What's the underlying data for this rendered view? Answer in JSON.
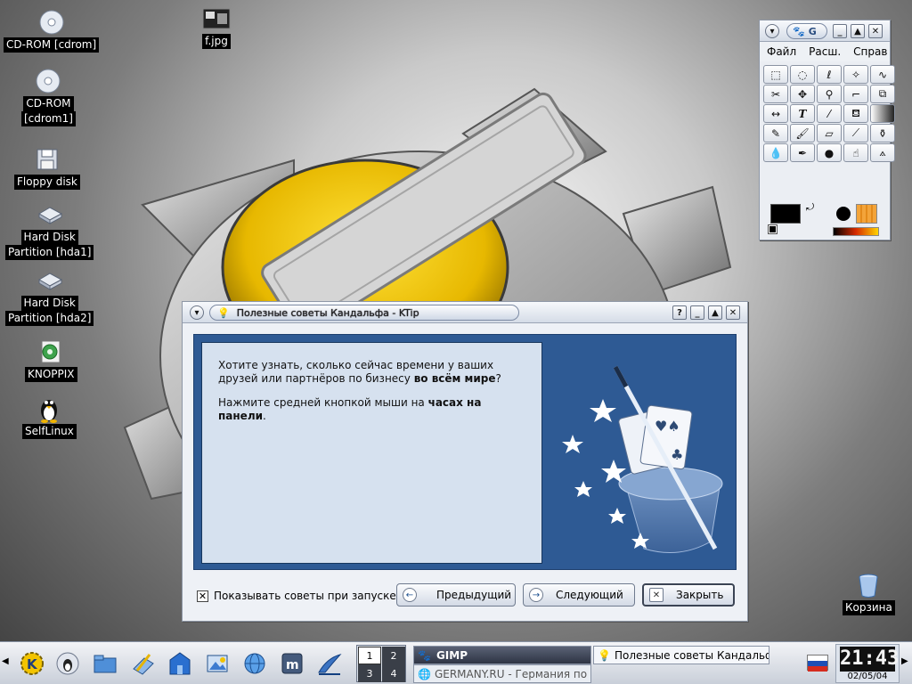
{
  "desktop": {
    "icons": [
      {
        "label": "CD-ROM [cdrom]",
        "icon": "cdrom-icon"
      },
      {
        "label": "CD-ROM",
        "label2": "[cdrom1]",
        "icon": "cdrom-icon"
      },
      {
        "label": "Floppy disk",
        "icon": "floppy-icon"
      },
      {
        "label": "Hard Disk",
        "label2": "Partition [hda1]",
        "icon": "harddisk-icon"
      },
      {
        "label": "Hard Disk",
        "label2": "Partition [hda2]",
        "icon": "harddisk-icon"
      },
      {
        "label": "KNOPPIX",
        "icon": "knoppix-icon"
      },
      {
        "label": "SelfLinux",
        "icon": "tux-icon"
      },
      {
        "label": "f.jpg",
        "icon": "image-file-icon"
      },
      {
        "label": "Корзина",
        "icon": "trash-icon"
      }
    ]
  },
  "gimp": {
    "title_letter": "G",
    "menu": [
      "Файл",
      "Расш.",
      "Справ"
    ],
    "tools": [
      "rect-select-icon",
      "ellipse-select-icon",
      "lasso-icon",
      "magic-wand-icon",
      "bezier-icon",
      "scissors-icon",
      "move-icon",
      "zoom-icon",
      "crop-icon",
      "transform-icon",
      "flip-icon",
      "text-icon",
      "color-picker-icon",
      "bucket-fill-icon",
      "blend-icon",
      "pencil-icon",
      "paintbrush-icon",
      "eraser-icon",
      "airbrush-icon",
      "clone-icon",
      "convolve-icon",
      "ink-icon",
      "dodge-burn-icon",
      "smudge-icon",
      "measure-icon"
    ],
    "fg_color": "#000000",
    "bg_color": "#ffffff"
  },
  "tip_dialog": {
    "title": "Полезные советы Кандальфа - KTip",
    "text1_prefix": "Хотите узнать, сколько сейчас времени у ваших друзей или партнёров по бизнесу ",
    "text1_bold": "во всём мире",
    "text1_suffix": "?",
    "text2_prefix": "Нажмите средней кнопкой мыши на ",
    "text2_bold": "часах на панели",
    "text2_suffix": ".",
    "checkbox_label": "Показывать советы при запуске",
    "checkbox_checked": true,
    "prev_label": "Предыдущий",
    "next_label": "Следующий",
    "close_label": "Закрыть"
  },
  "taskbar": {
    "pager": [
      "1",
      "2",
      "3",
      "4"
    ],
    "active_desktop": "1",
    "tasks": [
      {
        "label": "GIMP",
        "bold": true
      },
      {
        "label": "Полезные советы Кандальф",
        "bold": false
      },
      {
        "label": "GERMANY.RU - Германия по",
        "bold": false
      }
    ],
    "clock_time": "21:43",
    "clock_date": "02/05/04"
  }
}
